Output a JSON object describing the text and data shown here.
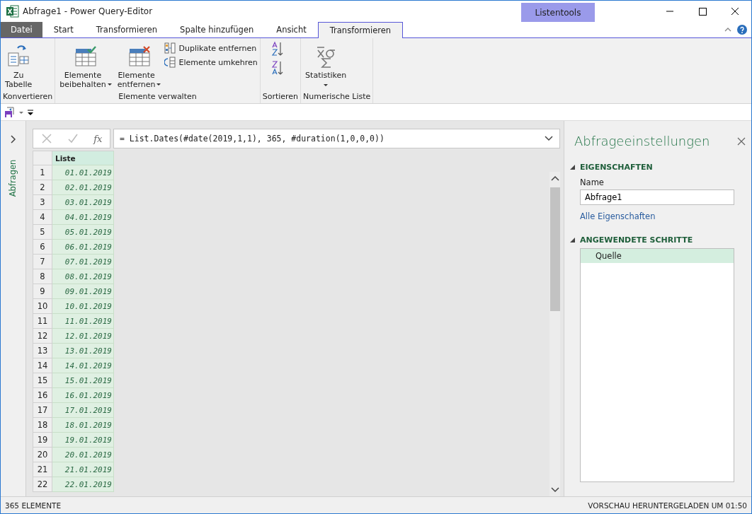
{
  "window": {
    "title": "Abfrage1 - Power Query-Editor",
    "context_tab_group": "Listentools"
  },
  "tabs": [
    {
      "label": "Datei",
      "kind": "file",
      "selected": false
    },
    {
      "label": "Start",
      "kind": "tab",
      "selected": false
    },
    {
      "label": "Transformieren",
      "kind": "tab",
      "selected": false
    },
    {
      "label": "Spalte hinzufügen",
      "kind": "tab",
      "selected": false
    },
    {
      "label": "Ansicht",
      "kind": "tab",
      "selected": false
    },
    {
      "label": "Transformieren",
      "kind": "context",
      "selected": true
    }
  ],
  "ribbon": [
    {
      "label": "Konvertieren",
      "items": [
        {
          "kind": "large",
          "label": "Zu\nTabelle"
        }
      ]
    },
    {
      "label": "Elemente verwalten",
      "items": [
        {
          "kind": "large",
          "label": "Elemente\nbeibehalten",
          "dropdown": true
        },
        {
          "kind": "large",
          "label": "Elemente\nentfernen",
          "dropdown": true
        },
        {
          "kind": "small",
          "label": "Duplikate entfernen"
        },
        {
          "kind": "small",
          "label": "Elemente umkehren"
        }
      ]
    },
    {
      "label": "Sortieren",
      "items": [
        {
          "kind": "sort"
        },
        {
          "kind": "sort"
        }
      ]
    },
    {
      "label": "Numerische Liste",
      "items": [
        {
          "kind": "large",
          "label": "Statistiken",
          "dropdown": true
        }
      ]
    }
  ],
  "queries_pane": {
    "label": "Abfragen"
  },
  "formula_bar": {
    "function_label": "fx",
    "formula": "= List.Dates(#date(2019,1,1), 365, #duration(1,0,0,0))"
  },
  "table": {
    "columns": [
      "Liste"
    ],
    "rows": [
      [
        "1",
        "01.01.2019"
      ],
      [
        "2",
        "02.01.2019"
      ],
      [
        "3",
        "03.01.2019"
      ],
      [
        "4",
        "04.01.2019"
      ],
      [
        "5",
        "05.01.2019"
      ],
      [
        "6",
        "06.01.2019"
      ],
      [
        "7",
        "07.01.2019"
      ],
      [
        "8",
        "08.01.2019"
      ],
      [
        "9",
        "09.01.2019"
      ],
      [
        "10",
        "10.01.2019"
      ],
      [
        "11",
        "11.01.2019"
      ],
      [
        "12",
        "12.01.2019"
      ],
      [
        "13",
        "13.01.2019"
      ],
      [
        "14",
        "14.01.2019"
      ],
      [
        "15",
        "15.01.2019"
      ],
      [
        "16",
        "16.01.2019"
      ],
      [
        "17",
        "17.01.2019"
      ],
      [
        "18",
        "18.01.2019"
      ],
      [
        "19",
        "19.01.2019"
      ],
      [
        "20",
        "20.01.2019"
      ],
      [
        "21",
        "21.01.2019"
      ],
      [
        "22",
        "22.01.2019"
      ]
    ]
  },
  "settings": {
    "title": "Abfrageeinstellungen",
    "properties_heading": "EIGENSCHAFTEN",
    "name_label": "Name",
    "name_value": "Abfrage1",
    "all_properties_link": "Alle Eigenschaften",
    "steps_heading": "ANGEWENDETE SCHRITTE",
    "steps": [
      {
        "label": "Quelle",
        "selected": true
      }
    ]
  },
  "status_bar": {
    "left": "365 ELEMENTE",
    "right": "VORSCHAU HERUNTERGELADEN UM 01:50"
  }
}
